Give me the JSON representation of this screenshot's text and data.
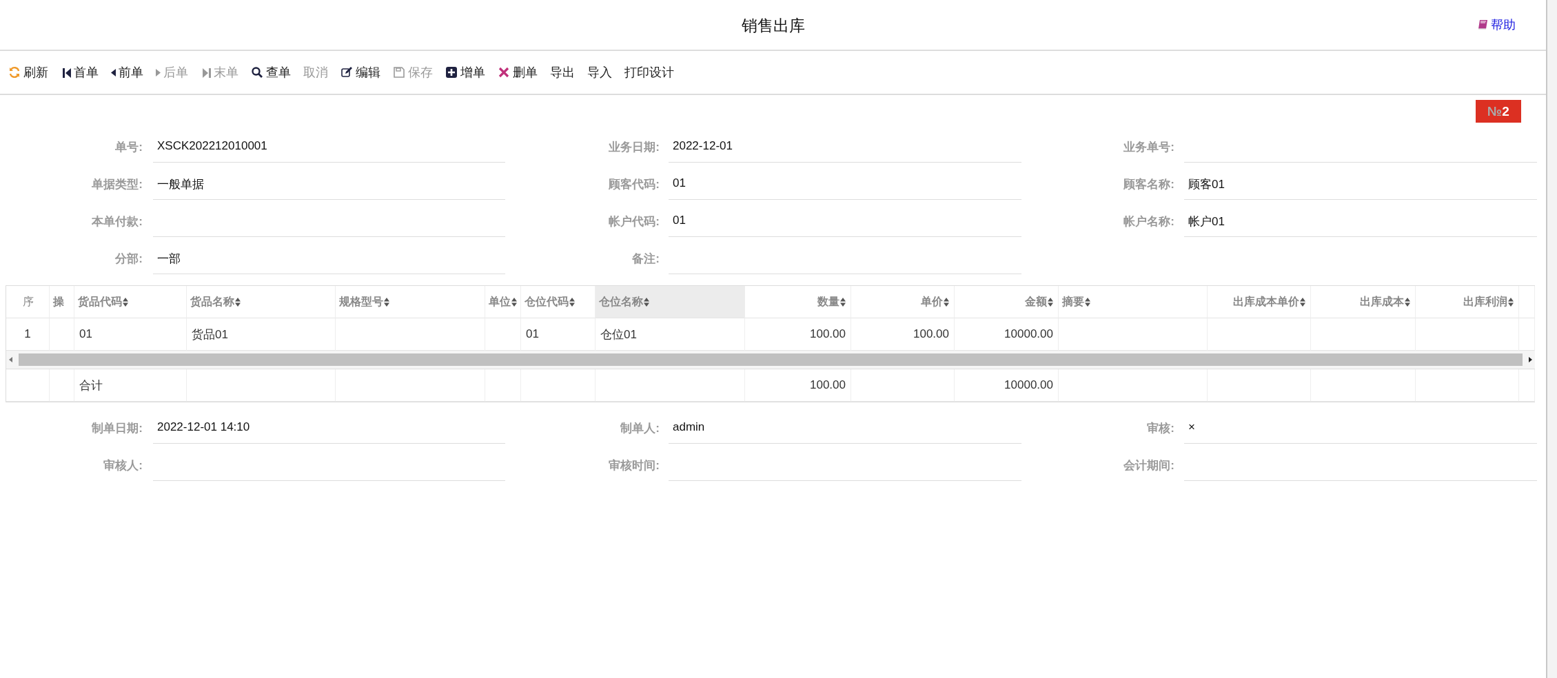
{
  "title": "销售出库",
  "help": {
    "label": "帮助"
  },
  "toolbar": [
    {
      "label": "刷新",
      "disabled": false
    },
    {
      "label": "首单",
      "disabled": false
    },
    {
      "label": "前单",
      "disabled": false
    },
    {
      "label": "后单",
      "disabled": true
    },
    {
      "label": "末单",
      "disabled": true
    },
    {
      "label": "查单",
      "disabled": false
    },
    {
      "label": "取消",
      "disabled": true
    },
    {
      "label": "编辑",
      "disabled": false
    },
    {
      "label": "保存",
      "disabled": true
    },
    {
      "label": "增单",
      "disabled": false
    },
    {
      "label": "删单",
      "disabled": false
    },
    {
      "label": "导出",
      "disabled": false
    },
    {
      "label": "导入",
      "disabled": false
    },
    {
      "label": "打印设计",
      "disabled": false
    }
  ],
  "badge": {
    "prefix": "№",
    "number": "2"
  },
  "header_fields": [
    {
      "label": "单号:",
      "value": "XSCK202212010001"
    },
    {
      "label": "业务日期:",
      "value": "2022-12-01"
    },
    {
      "label": "业务单号:"
    },
    {
      "label": "单据类型:",
      "value": "一般单据"
    },
    {
      "label": "顾客代码:",
      "value": "01"
    },
    {
      "label": "顾客名称:",
      "value": "顾客01"
    },
    {
      "label": "本单付款:"
    },
    {
      "label": "帐户代码:",
      "value": "01"
    },
    {
      "label": "帐户名称:",
      "value": "帐户01"
    },
    {
      "label": "分部:",
      "value": "一部"
    },
    {
      "label": "备注:"
    }
  ],
  "table": {
    "columns": [
      {
        "label": "序",
        "kind": "index",
        "sortable": false,
        "highlighted": false
      },
      {
        "label": "操",
        "kind": "text",
        "sortable": false,
        "highlighted": false
      },
      {
        "label": "货品代码",
        "kind": "text",
        "sortable": true,
        "highlighted": false
      },
      {
        "label": "货品名称",
        "kind": "text",
        "sortable": true,
        "highlighted": false
      },
      {
        "label": "规格型号",
        "kind": "text",
        "sortable": true,
        "highlighted": false
      },
      {
        "label": "单位",
        "kind": "text",
        "sortable": true,
        "highlighted": false
      },
      {
        "label": "仓位代码",
        "kind": "text",
        "sortable": true,
        "highlighted": false
      },
      {
        "label": "仓位名称",
        "kind": "text",
        "sortable": true,
        "highlighted": true
      },
      {
        "label": "数量",
        "kind": "number",
        "sortable": true,
        "highlighted": false
      },
      {
        "label": "单价",
        "kind": "number",
        "sortable": true,
        "highlighted": false
      },
      {
        "label": "金额",
        "kind": "number",
        "sortable": true,
        "highlighted": false
      },
      {
        "label": "摘要",
        "kind": "text",
        "sortable": true,
        "highlighted": false
      },
      {
        "label": "出库成本单价",
        "kind": "number",
        "sortable": true,
        "highlighted": false
      },
      {
        "label": "出库成本",
        "kind": "number",
        "sortable": true,
        "highlighted": false
      },
      {
        "label": "出库利润",
        "kind": "number",
        "sortable": true,
        "highlighted": false
      }
    ],
    "rows": [
      {
        "index": "1",
        "item_code": "01",
        "item_name": "货品01",
        "location_code": "01",
        "location_name": "仓位01",
        "quantity": "100.00",
        "unit_price": "100.00",
        "amount": "10000.00"
      }
    ],
    "footer": {
      "item_code": "合计",
      "quantity": "100.00",
      "amount": "10000.00"
    }
  },
  "footer_fields": [
    {
      "label": "制单日期:",
      "value": "2022-12-01 14:10"
    },
    {
      "label": "制单人:",
      "value": "admin"
    },
    {
      "label": "审核:",
      "value": "×"
    },
    {
      "label": "审核人:"
    },
    {
      "label": "审核时间:"
    },
    {
      "label": "会计期间:"
    }
  ]
}
